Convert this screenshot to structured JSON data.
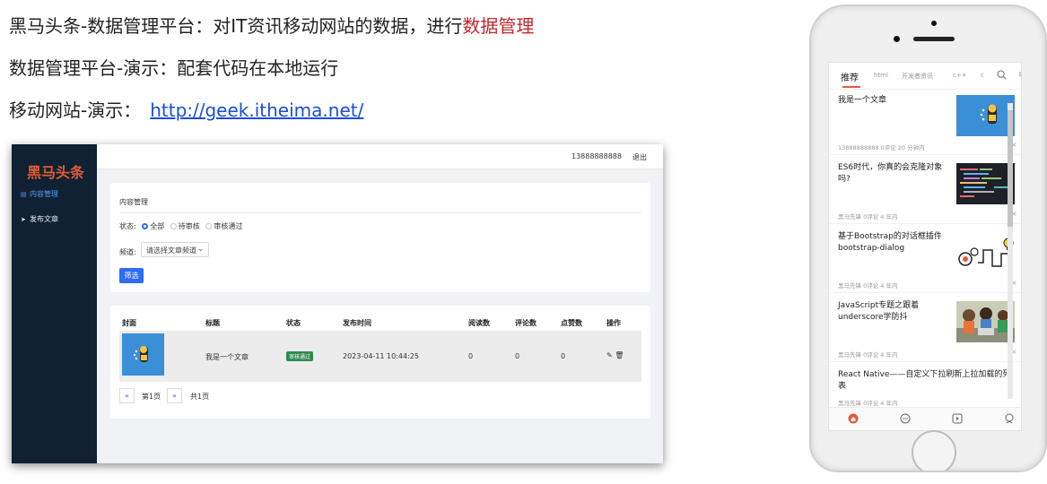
{
  "slide": {
    "line1_prefix": "黑马头条-数据管理平台：对IT资讯移动网站的数据，进行",
    "line1_highlight": "数据管理",
    "line2": "数据管理平台-演示：配套代码在本地运行",
    "line3_prefix": "移动网站-演示：",
    "line3_link": "http://geek.itheima.net/"
  },
  "admin": {
    "logo": "黑马头条",
    "nav": [
      "内容管理",
      "发布文章"
    ],
    "phone": "13888888888",
    "logout": "退出",
    "filter": {
      "title": "内容管理",
      "status_label": "状态:",
      "status_options": [
        "全部",
        "待审核",
        "审核通过"
      ],
      "status_selected": "全部",
      "channel_label": "频道:",
      "channel_placeholder": "请选择文章频道",
      "filter_button": "筛选"
    },
    "table": {
      "headers": [
        "封面",
        "标题",
        "状态",
        "发布时间",
        "阅读数",
        "评论数",
        "点赞数",
        "操作"
      ],
      "rows": [
        {
          "title": "我是一个文章",
          "status": "审核通过",
          "time": "2023-04-11 10:44:25",
          "reads": "0",
          "comments": "0",
          "likes": "0"
        }
      ]
    },
    "pagination": {
      "prev": "«",
      "page": "第1页",
      "next": "»",
      "total": "共1页"
    }
  },
  "mobile": {
    "tabs": [
      "推荐",
      "html",
      "开发者资讯",
      "c++",
      "c"
    ],
    "active_tab": "推荐",
    "articles": [
      {
        "title": "我是一个文章",
        "meta": "13888888888   0评论   20 分钟内",
        "thumb": "robot-blue"
      },
      {
        "title": "ES6时代，你真的会克隆对象吗?",
        "meta": "黑马先锋   0评论   4 年内",
        "thumb": "code-dark"
      },
      {
        "title": "基于Bootstrap的对话框插件bootstrap-dialog",
        "meta": "黑马先锋   0评论   4 年内",
        "thumb": "bulb-gears"
      },
      {
        "title": "JavaScript专题之跟着underscore学防抖",
        "meta": "黑马先锋   0评论   4 年内",
        "thumb": "kids-laptop"
      },
      {
        "title": "React Native——自定义下拉刷新上拉加载的列表",
        "meta": "黑马先锋   0评论   4 年内",
        "thumb": ""
      }
    ],
    "tabbar": [
      "首页",
      "问答",
      "视频",
      "我的"
    ],
    "tabbar_active": "首页"
  },
  "colors": {
    "accent_red": "#c0282d",
    "link_blue": "#1a4fd6",
    "sidebar_bg": "#0f2133",
    "primary": "#2d6cf5",
    "mobile_accent": "#e8573a"
  }
}
